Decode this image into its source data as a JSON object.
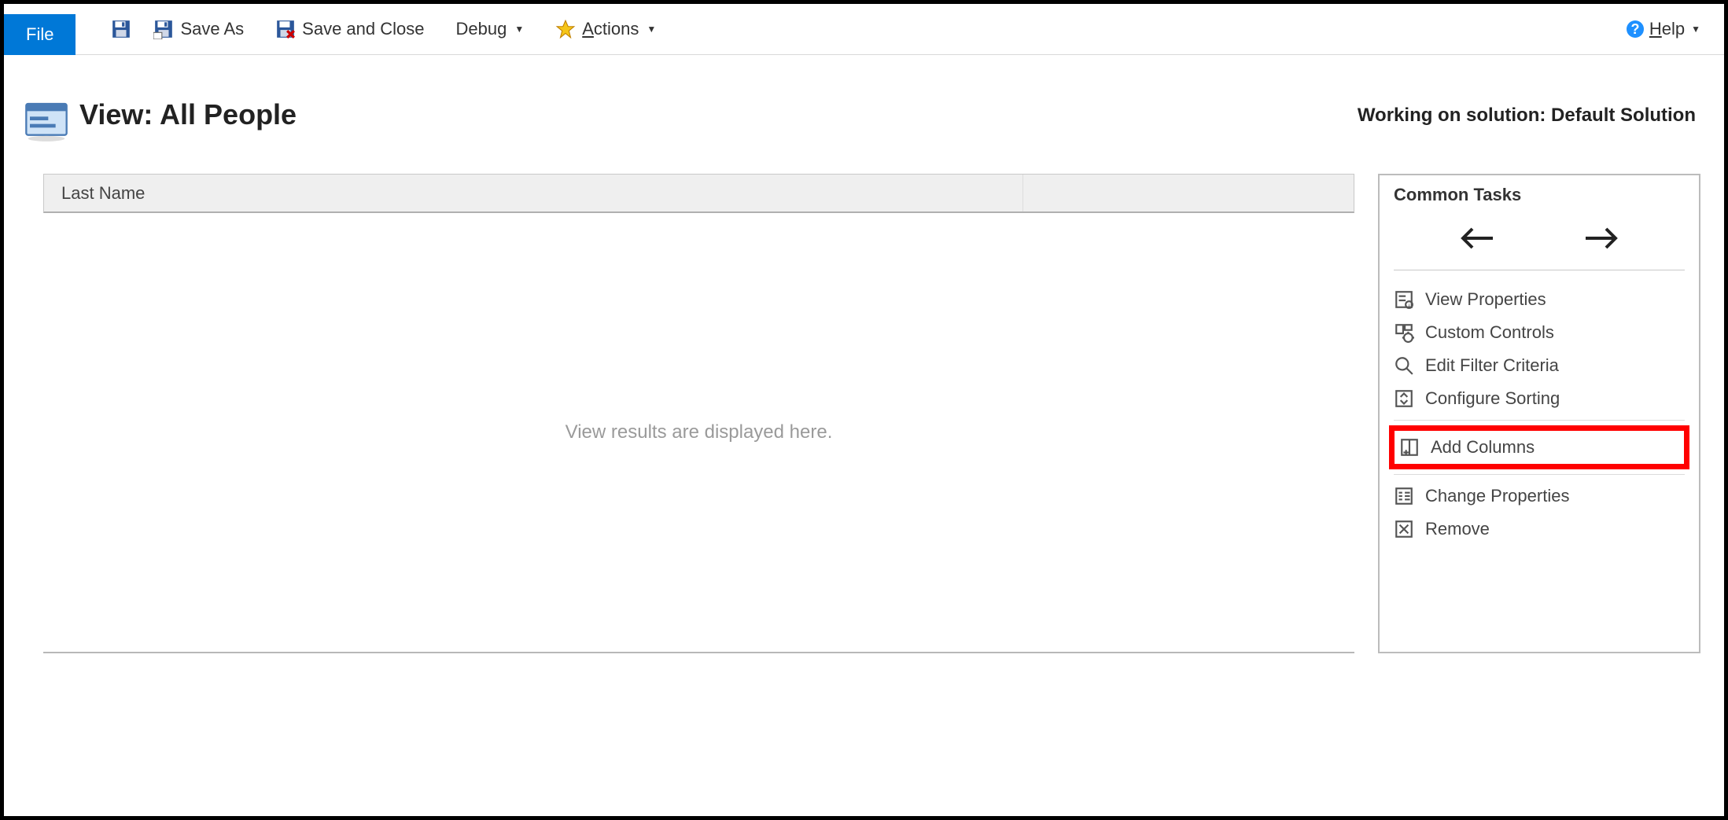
{
  "toolbar": {
    "file": "File",
    "save_as": "Save As",
    "save_close": "Save and Close",
    "debug": "Debug",
    "actions": "Actions",
    "help": "Help"
  },
  "title": {
    "label": "View: All People"
  },
  "solution": {
    "prefix": "Working on solution: ",
    "name": "Default Solution"
  },
  "grid": {
    "columns": [
      "Last Name"
    ],
    "empty_message": "View results are displayed here."
  },
  "tasks": {
    "title": "Common Tasks",
    "items": {
      "view_properties": "View Properties",
      "custom_controls": "Custom Controls",
      "edit_filter": "Edit Filter Criteria",
      "configure_sorting": "Configure Sorting",
      "add_columns": "Add Columns",
      "change_properties": "Change Properties",
      "remove": "Remove"
    }
  }
}
